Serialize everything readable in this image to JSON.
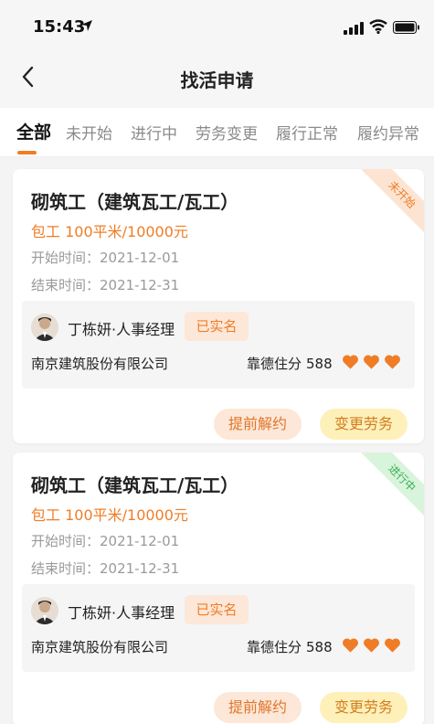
{
  "status_bar": {
    "time": "15:43"
  },
  "header": {
    "title": "找活申请"
  },
  "tabs": [
    {
      "label": "全部",
      "active": true
    },
    {
      "label": "未开始",
      "active": false
    },
    {
      "label": "进行中",
      "active": false
    },
    {
      "label": "劳务变更",
      "active": false
    },
    {
      "label": "履行正常",
      "active": false
    },
    {
      "label": "履约异常",
      "active": false
    }
  ],
  "colors": {
    "accent": "#ef7d26",
    "pending_badge": "#fde4d2",
    "active_badge": "#d8f5dc",
    "active_text": "#3cae52",
    "change_button": "#fdf0b9"
  },
  "cards": [
    {
      "title": "砌筑工（建筑瓦工/瓦工）",
      "price": "包工 100平米/10000元",
      "start": "开始时间：2021-12-01",
      "end": "结束时间：2021-12-31",
      "status": "未开始",
      "contact": "丁栋妍·人事经理",
      "verified": "已实名",
      "company": "南京建筑股份有限公司",
      "credit_label": "靠德住分",
      "credit_score": "588",
      "hearts": 3,
      "actions": {
        "terminate": "提前解约",
        "change": "变更劳务"
      }
    },
    {
      "title": "砌筑工（建筑瓦工/瓦工）",
      "price": "包工 100平米/10000元",
      "start": "开始时间：2021-12-01",
      "end": "结束时间：2021-12-31",
      "status": "进行中",
      "contact": "丁栋妍·人事经理",
      "verified": "已实名",
      "company": "南京建筑股份有限公司",
      "credit_label": "靠德住分",
      "credit_score": "588",
      "hearts": 3,
      "actions": {
        "terminate": "提前解约",
        "change": "变更劳务"
      }
    }
  ]
}
